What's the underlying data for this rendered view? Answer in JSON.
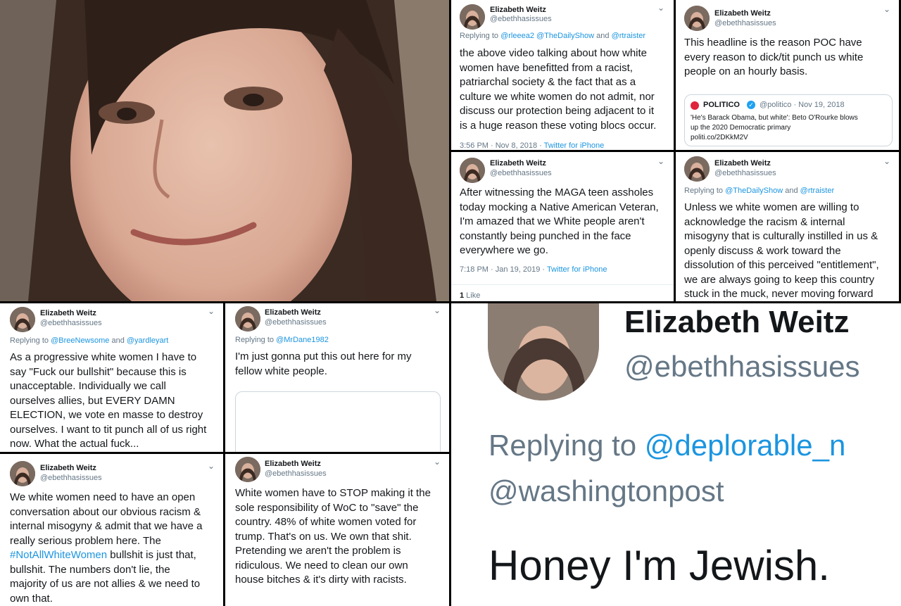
{
  "author": {
    "name": "Elizabeth Weitz",
    "handle": "@ebethhasissues"
  },
  "colors": {
    "link": "#1b95e0",
    "muted": "#657786",
    "text": "#14171a",
    "politico_red": "#e0243b",
    "verified_blue": "#1da1f2"
  },
  "tweets": [
    {
      "reply_prefix": "Replying to ",
      "reply_mentions": "@rleeea2 @TheDailyShow",
      "reply_and": " and ",
      "reply_mention_2": "@rtraister",
      "lines": [
        "the above video talking about how white",
        "women have benefitted from a racist,",
        "patriarchal society & the fact that as a",
        "culture we white women do not admit, nor",
        "discuss our protection being adjacent to it",
        "is a huge reason these voting blocs occur."
      ],
      "time": "3:56 PM · Nov 8, 2018 · ",
      "source": "Twitter for iPhone"
    },
    {
      "lines": [
        "This headline is the reason POC have",
        "every reason to dick/tit punch us white",
        "people on an hourly basis."
      ],
      "quote": {
        "name": "POLITICO",
        "meta": "@politico · Nov 19, 2018",
        "text_1": "'He's Barack Obama, but white': Beto O'Rourke blows",
        "text_2": "up the 2020 Democratic primary",
        "link": "politi.co/2DKkM2V"
      }
    },
    {
      "lines": [
        "After witnessing the MAGA teen assholes",
        "today mocking a Native American Veteran,",
        "I'm amazed that we White people aren't",
        "constantly being punched in the face",
        "everywhere we go."
      ],
      "time": "7:18 PM · Jan 19, 2019 · ",
      "source": "Twitter for iPhone",
      "likes_count": "1",
      "likes_label": " Like"
    },
    {
      "reply_prefix": "Replying to ",
      "reply_mentions": "@TheDailyShow",
      "reply_and": " and ",
      "reply_mention_2": "@rtraister",
      "lines": [
        "Unless we white women are willing to",
        "acknowledge the racism & internal",
        "misogyny that is culturally instilled in us &",
        "openly discuss & work toward the",
        "dissolution of this perceived \"entitlement\",",
        "we are always going to keep this country",
        "stuck in the muck, never moving forward"
      ]
    },
    {
      "reply_prefix": "Replying to ",
      "reply_mentions": "@BreeNewsome",
      "reply_and": " and ",
      "reply_mention_2": "@yardleyart",
      "lines": [
        "As a progressive white women I have to",
        "say \"Fuck our bullshit\" because this is",
        "unacceptable. Individually we call",
        "ourselves allies, but EVERY DAMN",
        "ELECTION, we vote en masse to destroy",
        "ourselves. I want to tit punch all of us right",
        "now. What the actual fuck..."
      ]
    },
    {
      "reply_prefix": "Replying to ",
      "reply_mentions": "@MrDane1982",
      "lines": [
        "I'm just gonna put this out here for my",
        "fellow white people."
      ]
    },
    {
      "lines": [
        "We white women need to have an open",
        "conversation about our obvious racism &",
        "internal misogyny & admit that we have a",
        "really serious problem here. The"
      ],
      "hashtag": "#NotAllWhiteWomen",
      "hashtag_rest": " bullshit is just that,",
      "lines_after": [
        "bullshit. The numbers don't lie, the",
        "majority of us are not allies & we need to",
        "own that."
      ]
    },
    {
      "lines": [
        "White women have to STOP making it the",
        "sole responsibility of WoC to \"save\" the",
        "country. 48% of white women voted for",
        "trump. That's on us. We own that shit.",
        "Pretending we aren't the problem is",
        "ridiculous. We need to clean our own",
        "house bitches & it's dirty with racists."
      ]
    }
  ],
  "zoomed": {
    "name": "Elizabeth Weitz",
    "handle": "@ebethhasissues",
    "reply_prefix": "Replying to ",
    "reply_mention": "@deplorable_n",
    "reply_mention_2": "@washingtonpost",
    "text": "Honey I'm Jewish."
  }
}
